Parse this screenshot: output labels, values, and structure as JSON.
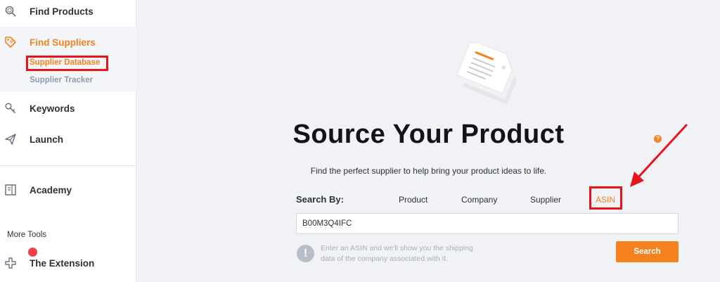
{
  "sidebar": {
    "items": [
      {
        "label": "Find Products",
        "icon": "search-icon"
      },
      {
        "label": "Find Suppliers",
        "icon": "tag-icon",
        "active": true
      },
      {
        "label": "Keywords",
        "icon": "key-icon"
      },
      {
        "label": "Launch",
        "icon": "paper-plane-icon"
      },
      {
        "label": "Academy",
        "icon": "book-icon"
      },
      {
        "label": "The Extension",
        "icon": "puzzle-icon"
      }
    ],
    "sub_items": [
      {
        "label": "Supplier Database",
        "active": true
      },
      {
        "label": "Supplier Tracker"
      }
    ],
    "more_tools_label": "More Tools"
  },
  "main": {
    "headline": "Source Your Product",
    "help_icon_glyph": "?",
    "subtitle": "Find the perfect supplier to help bring your product ideas to life.",
    "search_by_label": "Search By:",
    "tabs": [
      {
        "label": "Product"
      },
      {
        "label": "Company"
      },
      {
        "label": "Supplier"
      },
      {
        "label": "ASIN",
        "active": true
      }
    ],
    "search_value": "B00M3Q4IFC",
    "info_glyph": "!",
    "info_text": "Enter an ASIN and we'll show you the shipping data of the company associated with it.",
    "search_button_label": "Search"
  },
  "colors": {
    "accent": "#f5821f",
    "annotation_red": "#e8141b",
    "sidebar_text": "#2d3138",
    "muted": "#8d9aac"
  }
}
